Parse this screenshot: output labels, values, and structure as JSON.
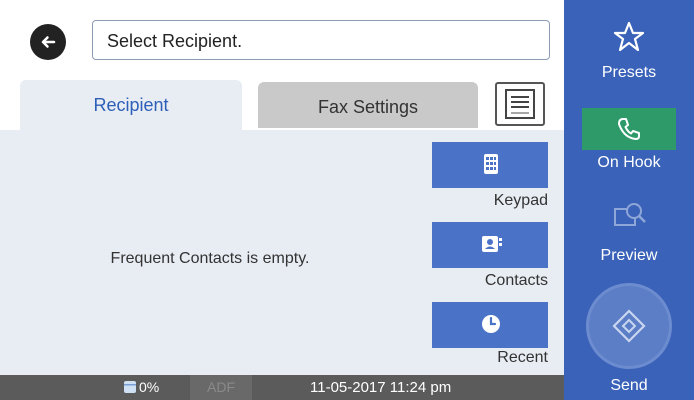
{
  "header": {
    "back_icon": "arrow-left-icon",
    "title_field_value": "Select Recipient."
  },
  "tabs": [
    {
      "label": "Recipient",
      "active": true
    },
    {
      "label": "Fax Settings",
      "active": false
    }
  ],
  "menu_icon": "menu-list-icon",
  "main": {
    "empty_message": "Frequent Contacts is empty."
  },
  "quick_buttons": [
    {
      "label": "Keypad",
      "icon": "keypad-icon"
    },
    {
      "label": "Contacts",
      "icon": "contacts-icon"
    },
    {
      "label": "Recent",
      "icon": "clock-icon"
    }
  ],
  "status_bar": {
    "ink_level": "0%",
    "adf": "ADF",
    "datetime": "11-05-2017 11:24 pm"
  },
  "sidebar": {
    "presets_label": "Presets",
    "on_hook_label": "On Hook",
    "preview_label": "Preview",
    "send_label": "Send"
  },
  "colors": {
    "sidebar": "#3a62b8",
    "accent_blue": "#4a73c7",
    "on_hook_green": "#2e9a6a",
    "tab_text": "#2d5fb8",
    "status_bar": "#5b5b5b"
  }
}
